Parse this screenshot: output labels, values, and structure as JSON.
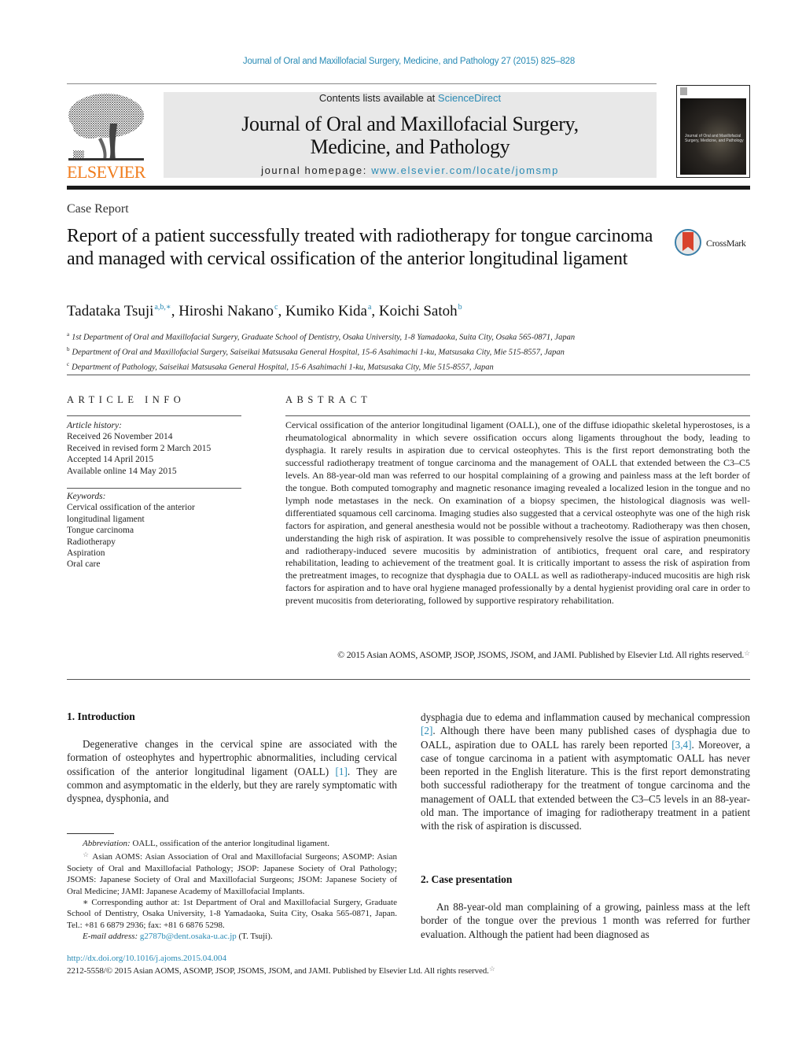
{
  "citation": "Journal of Oral and Maxillofacial Surgery, Medicine, and Pathology 27 (2015) 825–828",
  "masthead": {
    "publisher_logo_text": "ELSEVIER",
    "contents_prefix": "Contents lists available at ",
    "contents_link": "ScienceDirect",
    "journal_name_line1": "Journal of Oral and Maxillofacial Surgery,",
    "journal_name_line2": "Medicine, and Pathology",
    "homepage_prefix": "journal homepage: ",
    "homepage_link": "www.elsevier.com/locate/jomsmp",
    "cover_title": "Journal of Oral and Maxillofacial Surgery, Medicine, and Pathology"
  },
  "article": {
    "type": "Case Report",
    "title": "Report of a patient successfully treated with radiotherapy for tongue carcinoma and managed with cervical ossification of the anterior longitudinal ligament",
    "crossmark_label": "CrossMark",
    "authors": [
      {
        "name": "Tadataka Tsuji",
        "marks": "a,b,∗",
        "sep": ", "
      },
      {
        "name": "Hiroshi Nakano",
        "marks": "c",
        "sep": ", "
      },
      {
        "name": "Kumiko Kida",
        "marks": "a",
        "sep": ", "
      },
      {
        "name": "Koichi Satoh",
        "marks": "b",
        "sep": ""
      }
    ],
    "affiliations": [
      {
        "mark": "a",
        "text": "1st Department of Oral and Maxillofacial Surgery, Graduate School of Dentistry, Osaka University, 1-8 Yamadaoka, Suita City, Osaka 565-0871, Japan"
      },
      {
        "mark": "b",
        "text": "Department of Oral and Maxillofacial Surgery, Saiseikai Matsusaka General Hospital, 15-6 Asahimachi 1-ku, Matsusaka City, Mie 515-8557, Japan"
      },
      {
        "mark": "c",
        "text": "Department of Pathology, Saiseikai Matsusaka General Hospital, 15-6 Asahimachi 1-ku, Matsusaka City, Mie 515-8557, Japan"
      }
    ]
  },
  "article_info": {
    "heading": "ARTICLE INFO",
    "history_label": "Article history:",
    "history": [
      "Received 26 November 2014",
      "Received in revised form 2 March 2015",
      "Accepted 14 April 2015",
      "Available online 14 May 2015"
    ],
    "keywords_label": "Keywords:",
    "keywords": [
      "Cervical ossification of the anterior",
      "longitudinal ligament",
      "Tongue carcinoma",
      "Radiotherapy",
      "Aspiration",
      "Oral care"
    ]
  },
  "abstract": {
    "heading": "ABSTRACT",
    "text": "Cervical ossification of the anterior longitudinal ligament (OALL), one of the diffuse idiopathic skeletal hyperostoses, is a rheumatological abnormality in which severe ossification occurs along ligaments throughout the body, leading to dysphagia. It rarely results in aspiration due to cervical osteophytes. This is the first report demonstrating both the successful radiotherapy treatment of tongue carcinoma and the management of OALL that extended between the C3–C5 levels. An 88-year-old man was referred to our hospital complaining of a growing and painless mass at the left border of the tongue. Both computed tomography and magnetic resonance imaging revealed a localized lesion in the tongue and no lymph node metastases in the neck. On examination of a biopsy specimen, the histological diagnosis was well-differentiated squamous cell carcinoma. Imaging studies also suggested that a cervical osteophyte was one of the high risk factors for aspiration, and general anesthesia would not be possible without a tracheotomy. Radiotherapy was then chosen, understanding the high risk of aspiration. It was possible to comprehensively resolve the issue of aspiration pneumonitis and radiotherapy-induced severe mucositis by administration of antibiotics, frequent oral care, and respiratory rehabilitation, leading to achievement of the treatment goal. It is critically important to assess the risk of aspiration from the pretreatment images, to recognize that dysphagia due to OALL as well as radiotherapy-induced mucositis are high risk factors for aspiration and to have oral hygiene managed professionally by a dental hygienist providing oral care in order to prevent mucositis from deteriorating, followed by supportive respiratory rehabilitation.",
    "copyright": "© 2015 Asian AOMS, ASOMP, JSOP, JSOMS, JSOM, and JAMI. Published by Elsevier Ltd. All rights reserved."
  },
  "body": {
    "intro_heading": "1.  Introduction",
    "intro_part1": "Degenerative changes in the cervical spine are associated with the formation of osteophytes and hypertrophic abnormalities, including cervical ossification of the anterior longitudinal ligament (OALL) ",
    "intro_ref1": "[1]",
    "intro_part2": ". They are common and asymptomatic in the elderly, but they are rarely symptomatic with dyspnea, dysphonia, and",
    "right_part1": "dysphagia due to edema and inflammation caused by mechanical compression ",
    "right_ref2": "[2]",
    "right_part2": ". Although there have been many published cases of dysphagia due to OALL, aspiration due to OALL has rarely been reported ",
    "right_ref34": "[3,4]",
    "right_part3": ". Moreover, a case of tongue carcinoma in a patient with asymptomatic OALL has never been reported in the English literature. This is the first report demonstrating both successful radiotherapy for the treatment of tongue carcinoma and the management of OALL that extended between the C3–C5 levels in an 88-year-old man. The importance of imaging for radiotherapy treatment in a patient with the risk of aspiration is discussed.",
    "case_heading": "2.  Case presentation",
    "case_text": "An 88-year-old man complaining of a growing, painless mass at the left border of the tongue over the previous 1 month was referred for further evaluation. Although the patient had been diagnosed as"
  },
  "footnotes": {
    "abbrev_label": "Abbreviation:",
    "abbrev_text": " OALL, ossification of the anterior longitudinal ligament.",
    "societies": "Asian AOMS: Asian Association of Oral and Maxillofacial Surgeons; ASOMP: Asian Society of Oral and Maxillofacial Pathology; JSOP: Japanese Society of Oral Pathology; JSOMS: Japanese Society of Oral and Maxillofacial Surgeons; JSOM: Japanese Society of Oral Medicine; JAMI: Japanese Academy of Maxillofacial Implants.",
    "corresponding": "Corresponding author at: 1st Department of Oral and Maxillofacial Surgery, Graduate School of Dentistry, Osaka University, 1-8 Yamadaoka, Suita City, Osaka 565-0871, Japan. Tel.: +81 6 6879 2936; fax: +81 6 6876 5298.",
    "email_label": "E-mail address:",
    "email": "g2787b@dent.osaka-u.ac.jp",
    "email_suffix": " (T. Tsuji)."
  },
  "footer": {
    "doi": "http://dx.doi.org/10.1016/j.ajoms.2015.04.004",
    "issn_line": "2212-5558/© 2015 Asian AOMS, ASOMP, JSOP, JSOMS, JSOM, and JAMI. Published by Elsevier Ltd. All rights reserved."
  },
  "colors": {
    "link": "#2a8bb5",
    "elsevier_orange": "#f07c1c",
    "masthead_bg": "#e8e8e8",
    "crossmark_red": "#d8432d"
  }
}
